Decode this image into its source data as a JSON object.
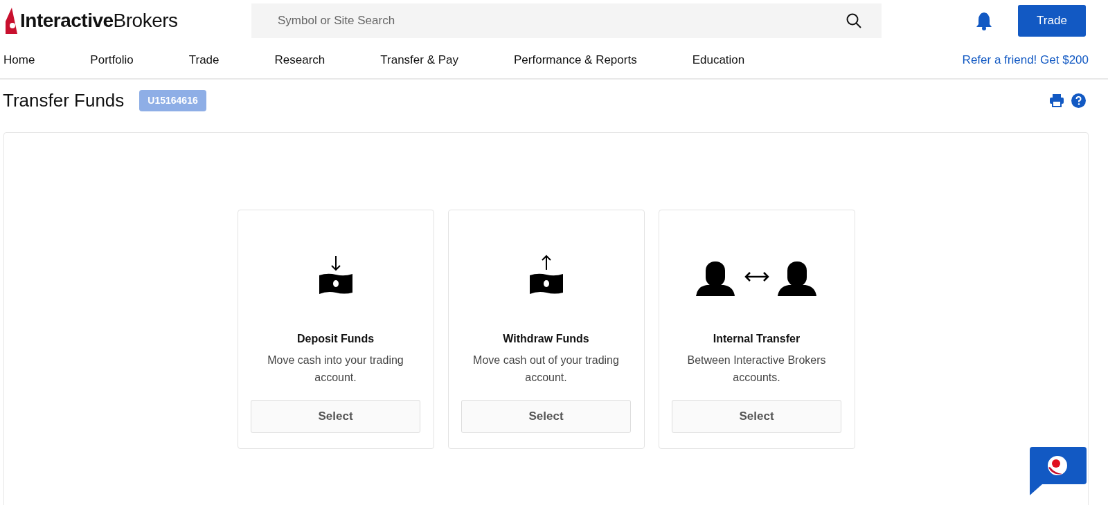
{
  "header": {
    "logo": "**Interactive**Brokers",
    "search": {
      "placeholder": "Symbol or Site Search"
    },
    "trade_button": "Trade"
  },
  "nav": {
    "items": [
      {
        "label": "Home"
      },
      {
        "label": "Portfolio"
      },
      {
        "label": "Trade"
      },
      {
        "label": "Research"
      },
      {
        "label": "Transfer & Pay"
      },
      {
        "label": "Performance & Reports"
      },
      {
        "label": "Education"
      }
    ],
    "promo_link": "Refer a friend! Get $200"
  },
  "page": {
    "title": "Transfer Funds",
    "account_badge": "U15164616"
  },
  "options": [
    {
      "kind": "deposit",
      "title": "Deposit Funds",
      "description": "Move cash into your trading account.",
      "button": "Select"
    },
    {
      "kind": "withdraw",
      "title": "Withdraw Funds",
      "description": "Move cash out of your trading account.",
      "button": "Select"
    },
    {
      "kind": "internal",
      "title": "Internal Transfer",
      "description": "Between Interactive Brokers accounts.",
      "button": "Select"
    }
  ]
}
